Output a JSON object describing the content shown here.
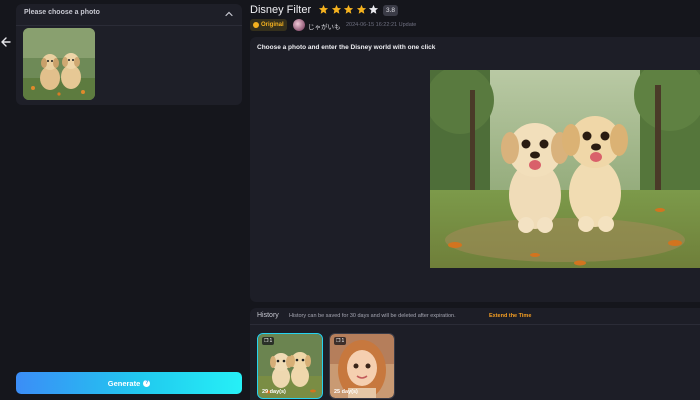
{
  "left_panel": {
    "title": "Please choose a photo"
  },
  "generate": {
    "label": "Generate"
  },
  "header": {
    "title": "Disney Filter",
    "rating": "3.8",
    "star_color": "#f5b21f",
    "original_badge": "Original",
    "author": "じゃがいも",
    "date": "2024-06-15 16:22:21 Update"
  },
  "stage": {
    "instruction": "Choose a photo and enter the Disney world with one click"
  },
  "history": {
    "title": "History",
    "note": "History can be saved for 30 days and will be deleted after expiration.",
    "extend_label": "Extend the Time",
    "items": [
      {
        "count": "1",
        "days": "29 day(s)",
        "selected": true
      },
      {
        "count": "1",
        "days": "25 day(s)",
        "selected": false
      }
    ]
  },
  "colors": {
    "accent_cyan": "#26d3f0",
    "extend_orange": "#f59e22",
    "background": "#15161c"
  }
}
